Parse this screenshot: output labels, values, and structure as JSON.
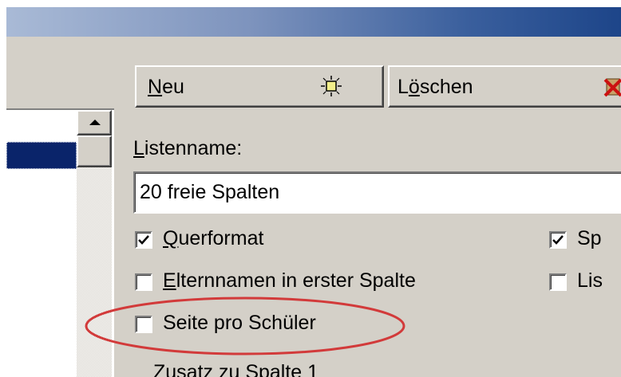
{
  "toolbar": {
    "new_button": {
      "label_parts": [
        "N",
        "eu"
      ],
      "icon": "new-sun-icon"
    },
    "delete_button": {
      "label_parts": [
        "L",
        "ö",
        "schen"
      ],
      "icon": "delete-x-icon"
    }
  },
  "form": {
    "listname_label_parts": [
      "L",
      "istenname:"
    ],
    "listname_value": "20 freie Spalten",
    "checkboxes": [
      {
        "label_parts": [
          "Q",
          "uerformat"
        ],
        "checked": true
      },
      {
        "label_parts": [
          "",
          "Sp"
        ],
        "checked": true
      },
      {
        "label_parts": [
          "E",
          "lternnamen in erster Spalte"
        ],
        "checked": false
      },
      {
        "label_parts": [
          "",
          "Lis"
        ],
        "checked": false
      },
      {
        "label_parts": [
          "",
          "Seite pro Schüler"
        ],
        "checked": false
      }
    ],
    "group_title": "Zusatz zu Spalte 1"
  },
  "annotation": {
    "highlight_color": "#d23a3a"
  },
  "colors": {
    "dialog_bg": "#d4d0c8",
    "selection": "#0a246a"
  }
}
